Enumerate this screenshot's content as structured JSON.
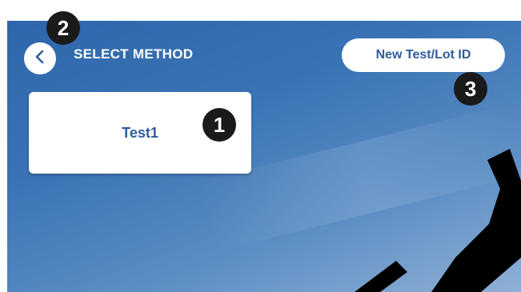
{
  "header": {
    "title": "SELECT METHOD",
    "back_icon": "chevron-left-icon",
    "new_test_label": "New Test/Lot ID"
  },
  "methods": [
    {
      "label": "Test1"
    }
  ],
  "callouts": {
    "one": "1",
    "two": "2",
    "three": "3"
  },
  "colors": {
    "background_top": "#2e66ab",
    "background_bottom": "#8fb0d6",
    "accent_text": "#2f5d9e",
    "callout": "#1a1a1a",
    "watermark": "#000000"
  }
}
